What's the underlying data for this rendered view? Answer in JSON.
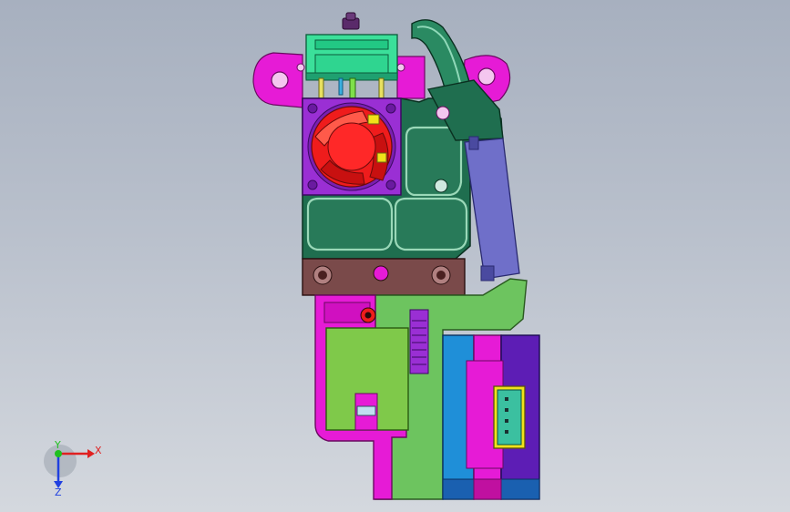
{
  "viewport": {
    "background_top": "#a7b0bf",
    "background_bottom": "#d4d8de"
  },
  "model": {
    "colors": {
      "magenta_mount": "#e61bd6",
      "green_body": "#1f6e4f",
      "light_green_plate": "#6dc45f",
      "lime_board": "#7fc94a",
      "fan_frame": "#9a2fd4",
      "fan_red": "#ef1c1c",
      "clip_teal": "#3be09a",
      "blue_motor": "#1f8fd8",
      "purple_motor": "#5d1db5",
      "brown_block": "#7a4a4a",
      "slate_bracket": "#6f6fc9",
      "yellow_connector": "#f0e21a"
    }
  },
  "triad": {
    "x_label": "X",
    "y_label": "Y",
    "z_label": "Z",
    "x_color": "#e02020",
    "y_color": "#20c020",
    "z_color": "#2040e0"
  }
}
